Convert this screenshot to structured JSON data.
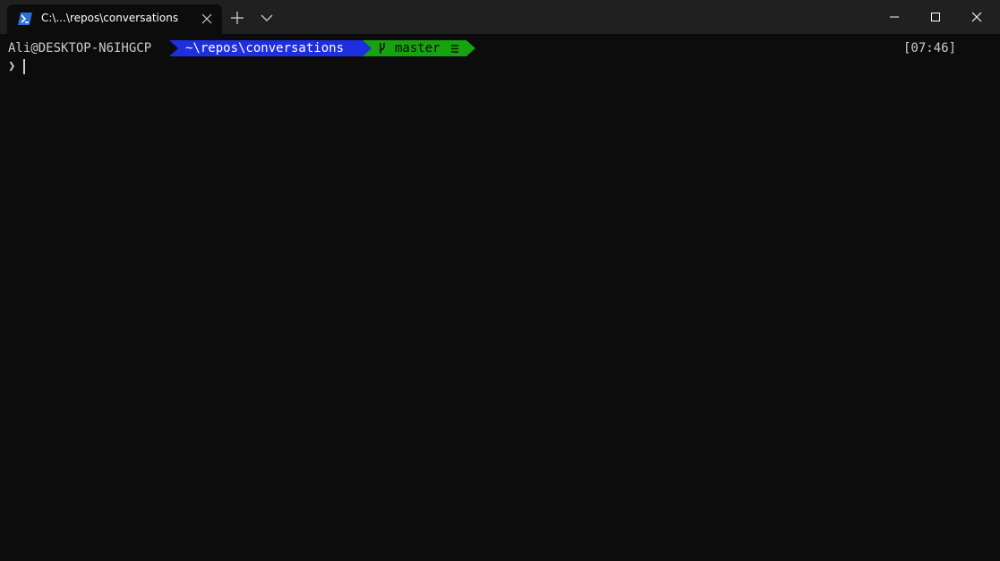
{
  "tab": {
    "title": "C:\\...\\repos\\conversations",
    "icon": "powershell-icon"
  },
  "toolbar": {
    "new_tab_icon": "plus-icon",
    "dropdown_icon": "chevron-down-icon"
  },
  "window_controls": {
    "minimize_icon": "minimize-icon",
    "maximize_icon": "maximize-icon",
    "close_icon": "close-icon"
  },
  "prompt": {
    "user_host": "Ali@DESKTOP-N6IHGCP",
    "path": "~\\repos\\conversations",
    "branch": "master",
    "branch_status": "≡",
    "time": "[07:46]",
    "chevron": "❯",
    "input_value": ""
  },
  "colors": {
    "terminal_bg": "#0c0c0c",
    "titlebar_bg": "#202020",
    "path_segment": "#1e2fe0",
    "branch_segment": "#16a30f",
    "text": "#cccccc"
  }
}
